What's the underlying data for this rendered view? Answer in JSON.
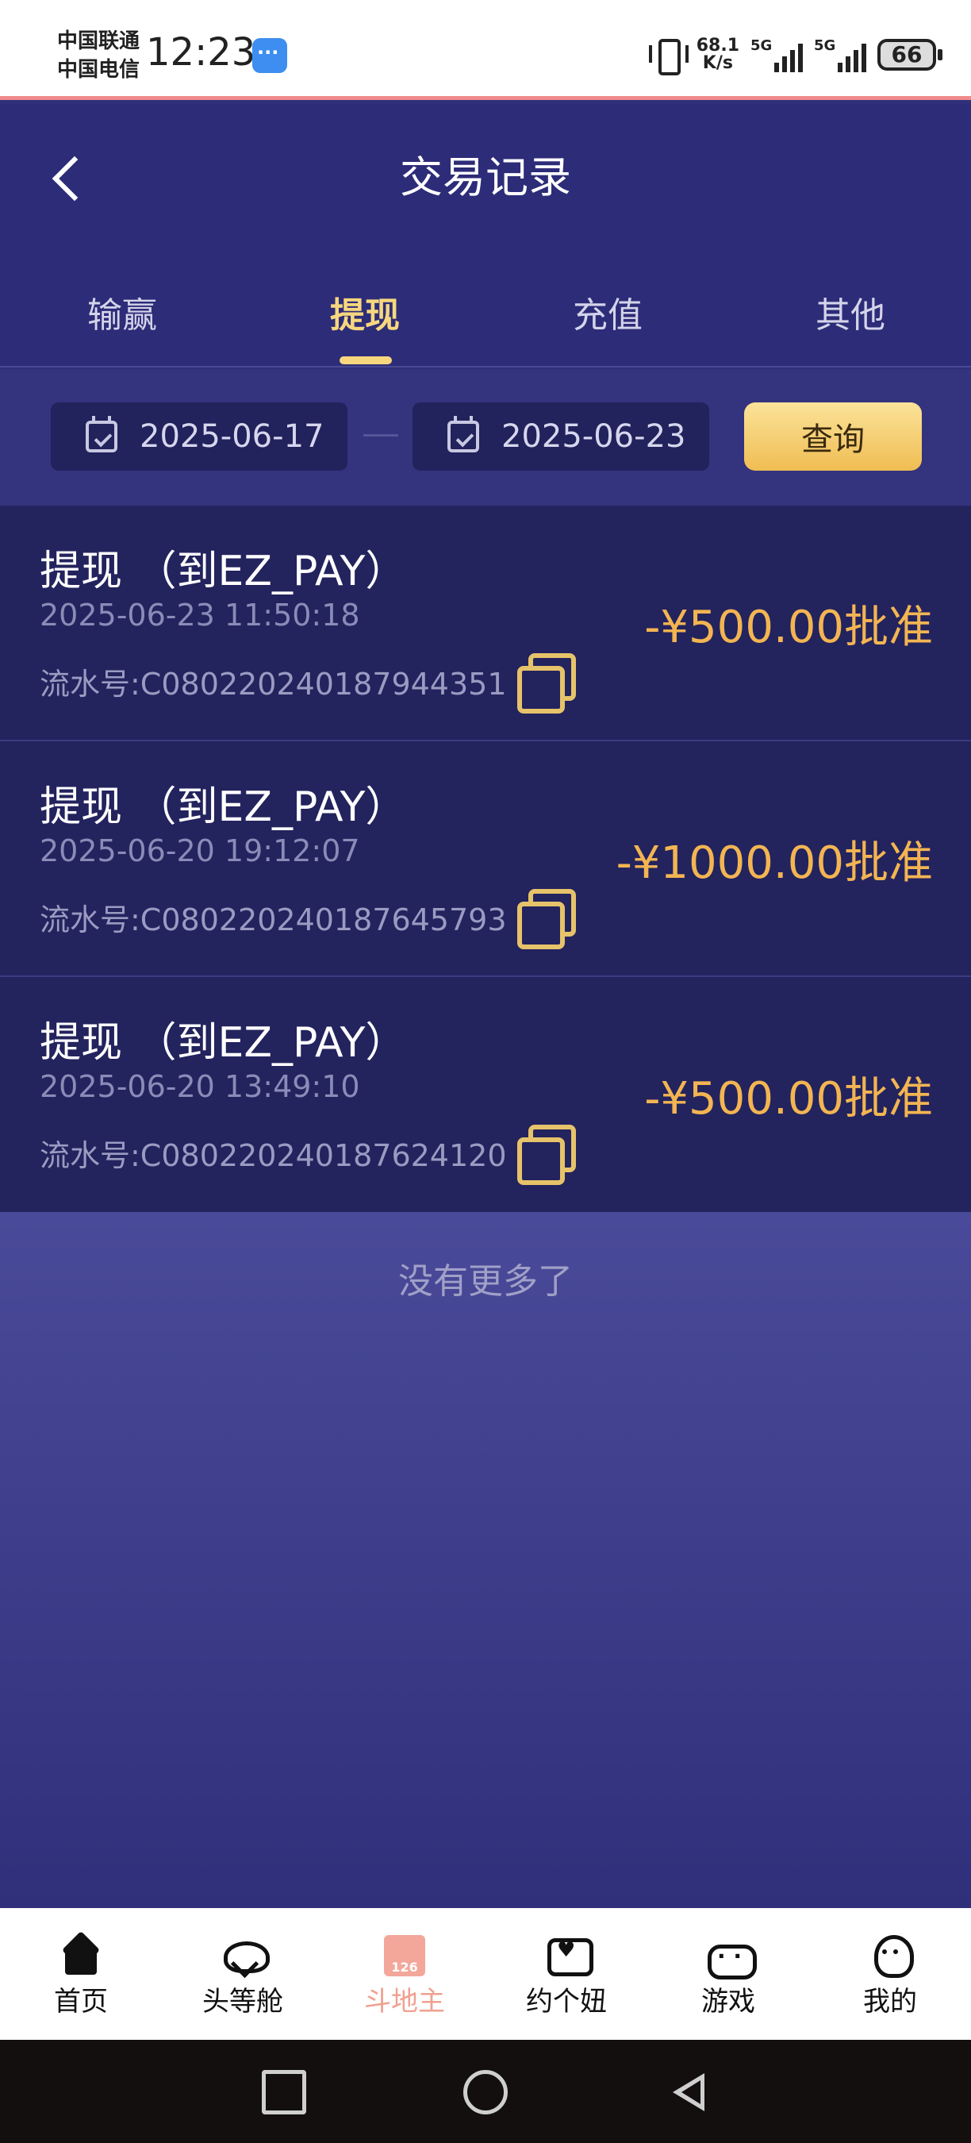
{
  "status_bar": {
    "carrier_1": "中国联通",
    "carrier_2": "中国电信",
    "time": "12:23",
    "net_speed_value": "68.1",
    "net_speed_unit": "K/s",
    "signal_1_label": "5G",
    "signal_2_label": "5G",
    "battery": "66"
  },
  "header": {
    "title": "交易记录"
  },
  "tabs": [
    {
      "label": "输赢",
      "active": false
    },
    {
      "label": "提现",
      "active": true
    },
    {
      "label": "充值",
      "active": false
    },
    {
      "label": "其他",
      "active": false
    }
  ],
  "filter": {
    "start_date": "2025-06-17",
    "separator": "—",
    "end_date": "2025-06-23",
    "query_label": "查询"
  },
  "records": [
    {
      "title": "提现 （到EZ_PAY）",
      "time": "2025-06-23 11:50:18",
      "serial": "流水号:C080220240187944351",
      "amount": "-¥500.00批准"
    },
    {
      "title": "提现 （到EZ_PAY）",
      "time": "2025-06-20 19:12:07",
      "serial": "流水号:C080220240187645793",
      "amount": "-¥1000.00批准"
    },
    {
      "title": "提现 （到EZ_PAY）",
      "time": "2025-06-20 13:49:10",
      "serial": "流水号:C080220240187624120",
      "amount": "-¥500.00批准"
    }
  ],
  "list_footer": "没有更多了",
  "bottom_nav": [
    {
      "label": "首页",
      "icon": "home-icon",
      "active": false
    },
    {
      "label": "头等舱",
      "icon": "plane-icon",
      "active": false
    },
    {
      "label": "斗地主",
      "icon": "doudizhu-icon",
      "active": true
    },
    {
      "label": "约个妞",
      "icon": "chat-heart-icon",
      "active": false
    },
    {
      "label": "游戏",
      "icon": "gamepad-icon",
      "active": false
    },
    {
      "label": "我的",
      "icon": "profile-icon",
      "active": false
    }
  ],
  "colors": {
    "header_bg": "#2d2c78",
    "accent_gold": "#f6d77e",
    "amount_orange": "#f3b552",
    "nav_active": "#f0a090"
  }
}
